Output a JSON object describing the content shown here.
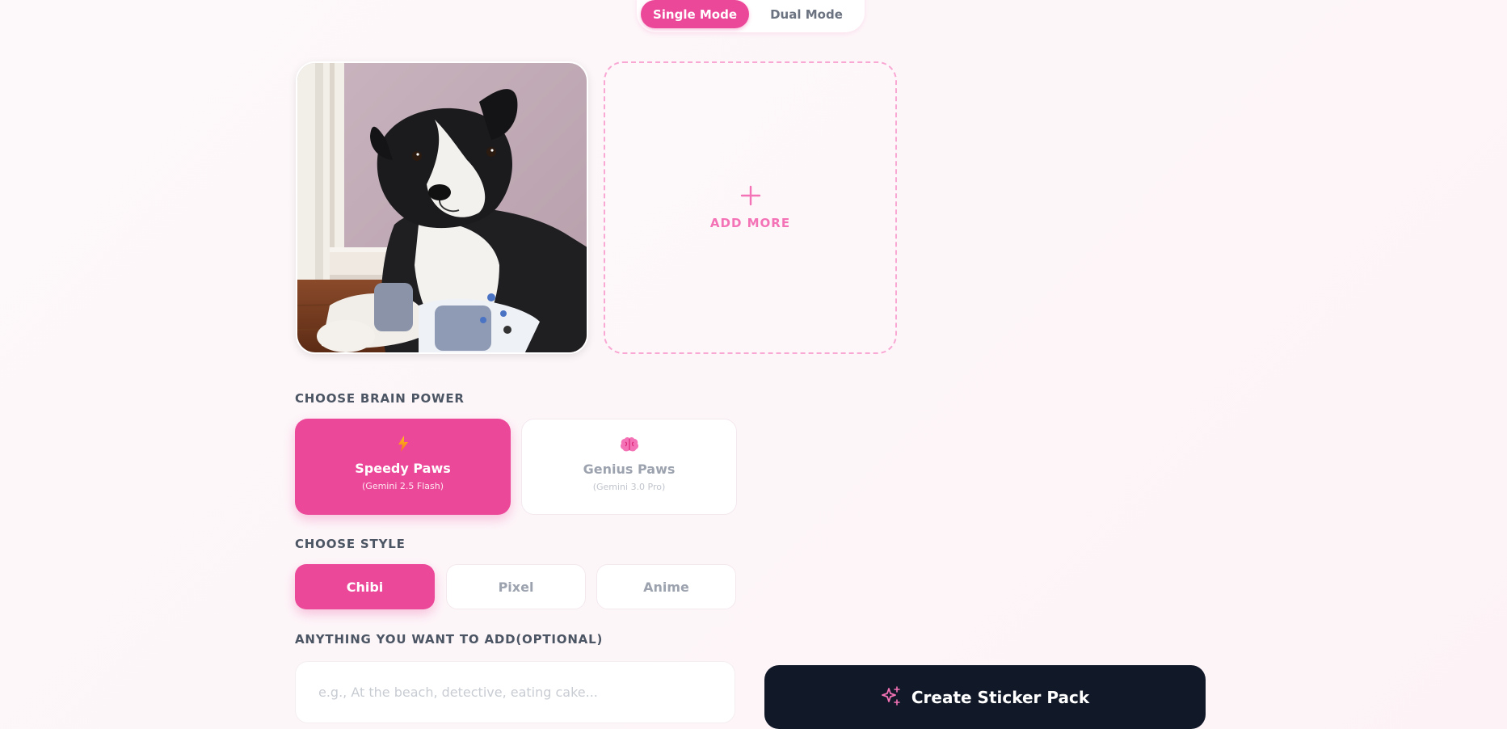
{
  "mode_toggle": {
    "single_label": "Single Mode",
    "dual_label": "Dual Mode",
    "selected": "Single Mode"
  },
  "upload": {
    "photo_alt": "Uploaded pet photo",
    "add_more_label": "ADD MORE",
    "add_icon": "plus-icon"
  },
  "brain_power": {
    "label": "CHOOSE BRAIN POWER",
    "options": [
      {
        "title": "Speedy Paws",
        "subtitle": "(Gemini 2.5 Flash)",
        "icon": "lightning-icon",
        "selected": true
      },
      {
        "title": "Genius Paws",
        "subtitle": "(Gemini 3.0 Pro)",
        "icon": "brain-icon",
        "selected": false
      }
    ]
  },
  "style": {
    "label": "CHOOSE STYLE",
    "options": [
      {
        "label": "Chibi",
        "selected": true
      },
      {
        "label": "Pixel",
        "selected": false
      },
      {
        "label": "Anime",
        "selected": false
      }
    ]
  },
  "extra": {
    "label": "ANYTHING YOU WANT TO ADD(OPTIONAL)",
    "placeholder": "e.g., At the beach, detective, eating cake...",
    "value": ""
  },
  "create": {
    "label": "Create Sticker Pack",
    "icon": "sparkles-icon"
  },
  "colors": {
    "accent": "#ec4899",
    "dark": "#111827",
    "muted": "#9ca3af"
  }
}
